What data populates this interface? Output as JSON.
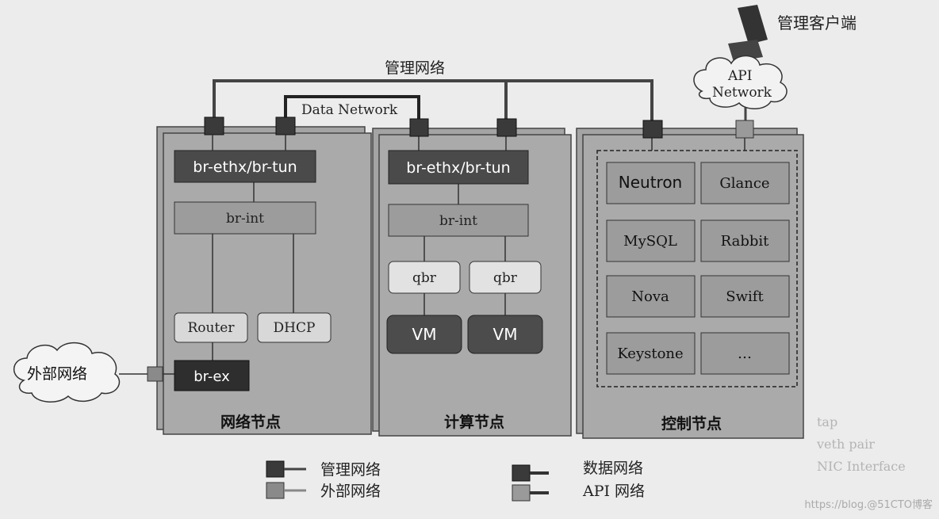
{
  "client": {
    "label": "管理客户端",
    "icon": "computer-icon"
  },
  "api_cloud": {
    "line1": "API",
    "line2": "Network"
  },
  "mgmt_network_label": "管理网络",
  "data_network_label": "Data Network",
  "external_cloud": {
    "label": "外部网络"
  },
  "network_node": {
    "title": "网络节点",
    "br_tun": "br-ethx/br-tun",
    "br_int": "br-int",
    "router": "Router",
    "dhcp": "DHCP",
    "br_ex": "br-ex"
  },
  "compute_node": {
    "title": "计算节点",
    "br_tun": "br-ethx/br-tun",
    "br_int": "br-int",
    "qbr1": "qbr",
    "qbr2": "qbr",
    "vm1": "VM",
    "vm2": "VM"
  },
  "control_node": {
    "title": "控制节点",
    "services": [
      "Neutron",
      "Glance",
      "MySQL",
      "Rabbit",
      "Nova",
      "Swift",
      "Keystone",
      "…"
    ]
  },
  "legend": [
    {
      "label": "管理网络",
      "color": "#3a3a3a"
    },
    {
      "label": "外部网络",
      "color": "#8a8a8a"
    },
    {
      "label": "数据网络",
      "color": "#3a3a3a"
    },
    {
      "label": "API 网络",
      "color": "#9a9a9a"
    }
  ],
  "faint_legend": [
    "tap",
    "veth pair",
    "NIC Interface"
  ],
  "watermark": "https://blog.@51CTO博客",
  "colors": {
    "panel": "#a8a8a8",
    "dark_box": "#4a4a4a",
    "mid_box": "#9c9c9c",
    "light_box": "#d8d8d8"
  }
}
